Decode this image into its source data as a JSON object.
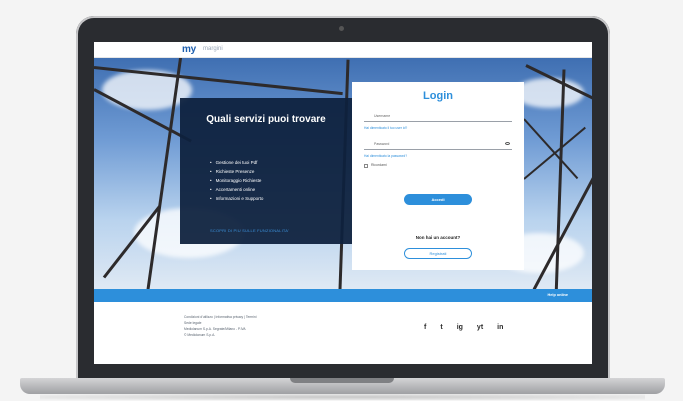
{
  "header": {
    "logo_main": "my",
    "logo_sub": "margini"
  },
  "info_panel": {
    "title": "Quali servizi puoi trovare",
    "items": [
      "Gestione dei tuoi Pdf",
      "Richieste Presenze",
      "Monitoraggio Richieste",
      "Accertamenti online",
      "Informazioni e Supporto"
    ],
    "link": "SCOPRI DI PIU SULLE FUNZIONALITA'"
  },
  "login": {
    "title": "Login",
    "username_label": "Username",
    "forgot_username": "Hai dimenticato il tuo user id?",
    "password_label": "Password",
    "forgot_password": "Hai dimenticato la password?",
    "remember": "Ricordami",
    "submit_label": "Accedi",
    "no_account_text": "Non hai un account?",
    "register_label": "Registrati"
  },
  "strip": {
    "link": "Help online"
  },
  "footer": {
    "links": "Condizioni d'utilizzo  |  Informativa privacy  |  Termini",
    "lines": [
      "Sede legale",
      "Mediolanum S.p.A. Segrate/Milano - P.IVA",
      "© Mediolanum S.p.A."
    ],
    "socials": [
      "f",
      "t",
      "ig",
      "yt",
      "in"
    ]
  },
  "colors": {
    "accent": "#2d8fdb",
    "panel": "#0e213e",
    "laptop": "#2a2c30"
  }
}
